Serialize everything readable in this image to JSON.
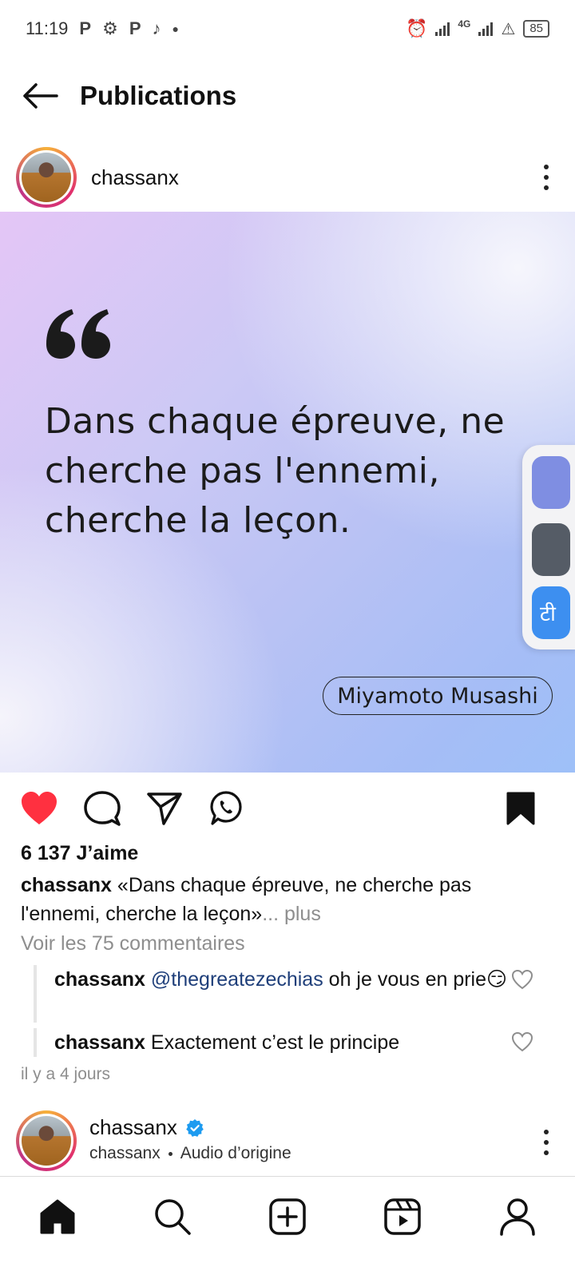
{
  "status_bar": {
    "time": "11:19",
    "network": "4G",
    "battery": "85",
    "icons": [
      "p-icon",
      "gear-icon",
      "p-icon",
      "tiktok-icon",
      "dot-icon",
      "alarm-icon",
      "signal-icon",
      "signal-icon",
      "lab-icon",
      "battery-icon"
    ]
  },
  "header": {
    "title": "Publications"
  },
  "post": {
    "username": "chassanx",
    "quote": "Dans chaque épreuve, ne cherche pas l'ennemi, cherche la leçon.",
    "author": "Miyamoto Musashi",
    "likes": "6 137 J’aime",
    "caption_user": "chassanx",
    "caption_text": "«Dans chaque épreuve, ne cherche pas l'ennemi, cherche la leçon»",
    "caption_more": "... plus",
    "view_comments": "Voir les 75 commentaires",
    "comments": [
      {
        "user": "chassanx",
        "mention": "@thegreatezechias",
        "text": " oh je vous en prie",
        "emoji": "😏"
      },
      {
        "user": "chassanx",
        "mention": "",
        "text": " Exactement c’est le principe",
        "emoji": ""
      }
    ],
    "time_ago": "il y a 4 jours",
    "liked": true,
    "saved": true
  },
  "side_panel": {
    "translate_label": "टी"
  },
  "next_post": {
    "username": "chassanx",
    "sub_user": "chassanx",
    "audio": "Audio d’origine",
    "verified": true
  },
  "bottom_nav": [
    "home-icon",
    "search-icon",
    "create-icon",
    "reels-icon",
    "profile-icon"
  ],
  "colors": {
    "like_red": "#ff3040",
    "verified_blue": "#1d9bf0",
    "muted_text": "#8e8e8e"
  }
}
